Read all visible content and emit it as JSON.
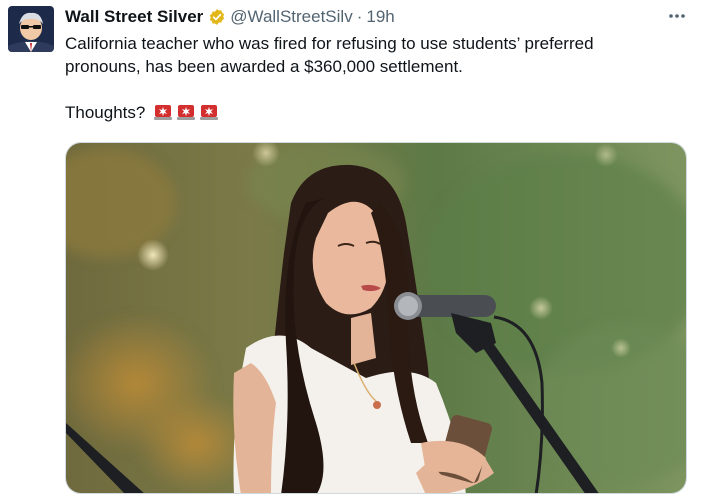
{
  "tweet": {
    "display_name": "Wall Street Silver",
    "verified": true,
    "verified_icon": "verified-badge-icon",
    "handle": "@WallStreetSilv",
    "separator": "·",
    "time": "19h",
    "more_icon": "more-options-icon",
    "text_lines": [
      "California teacher who was fired for refusing to use students’ preferred",
      "pronouns, has been awarded a $360,000 settlement."
    ],
    "thoughts": "Thoughts?",
    "emojis": [
      "police-light-icon",
      "police-light-icon",
      "police-light-icon"
    ]
  },
  "colors": {
    "text": "#0f1419",
    "secondary": "#536471",
    "verified_gold": "#e2b719",
    "siren_red": "#d32f2f"
  }
}
